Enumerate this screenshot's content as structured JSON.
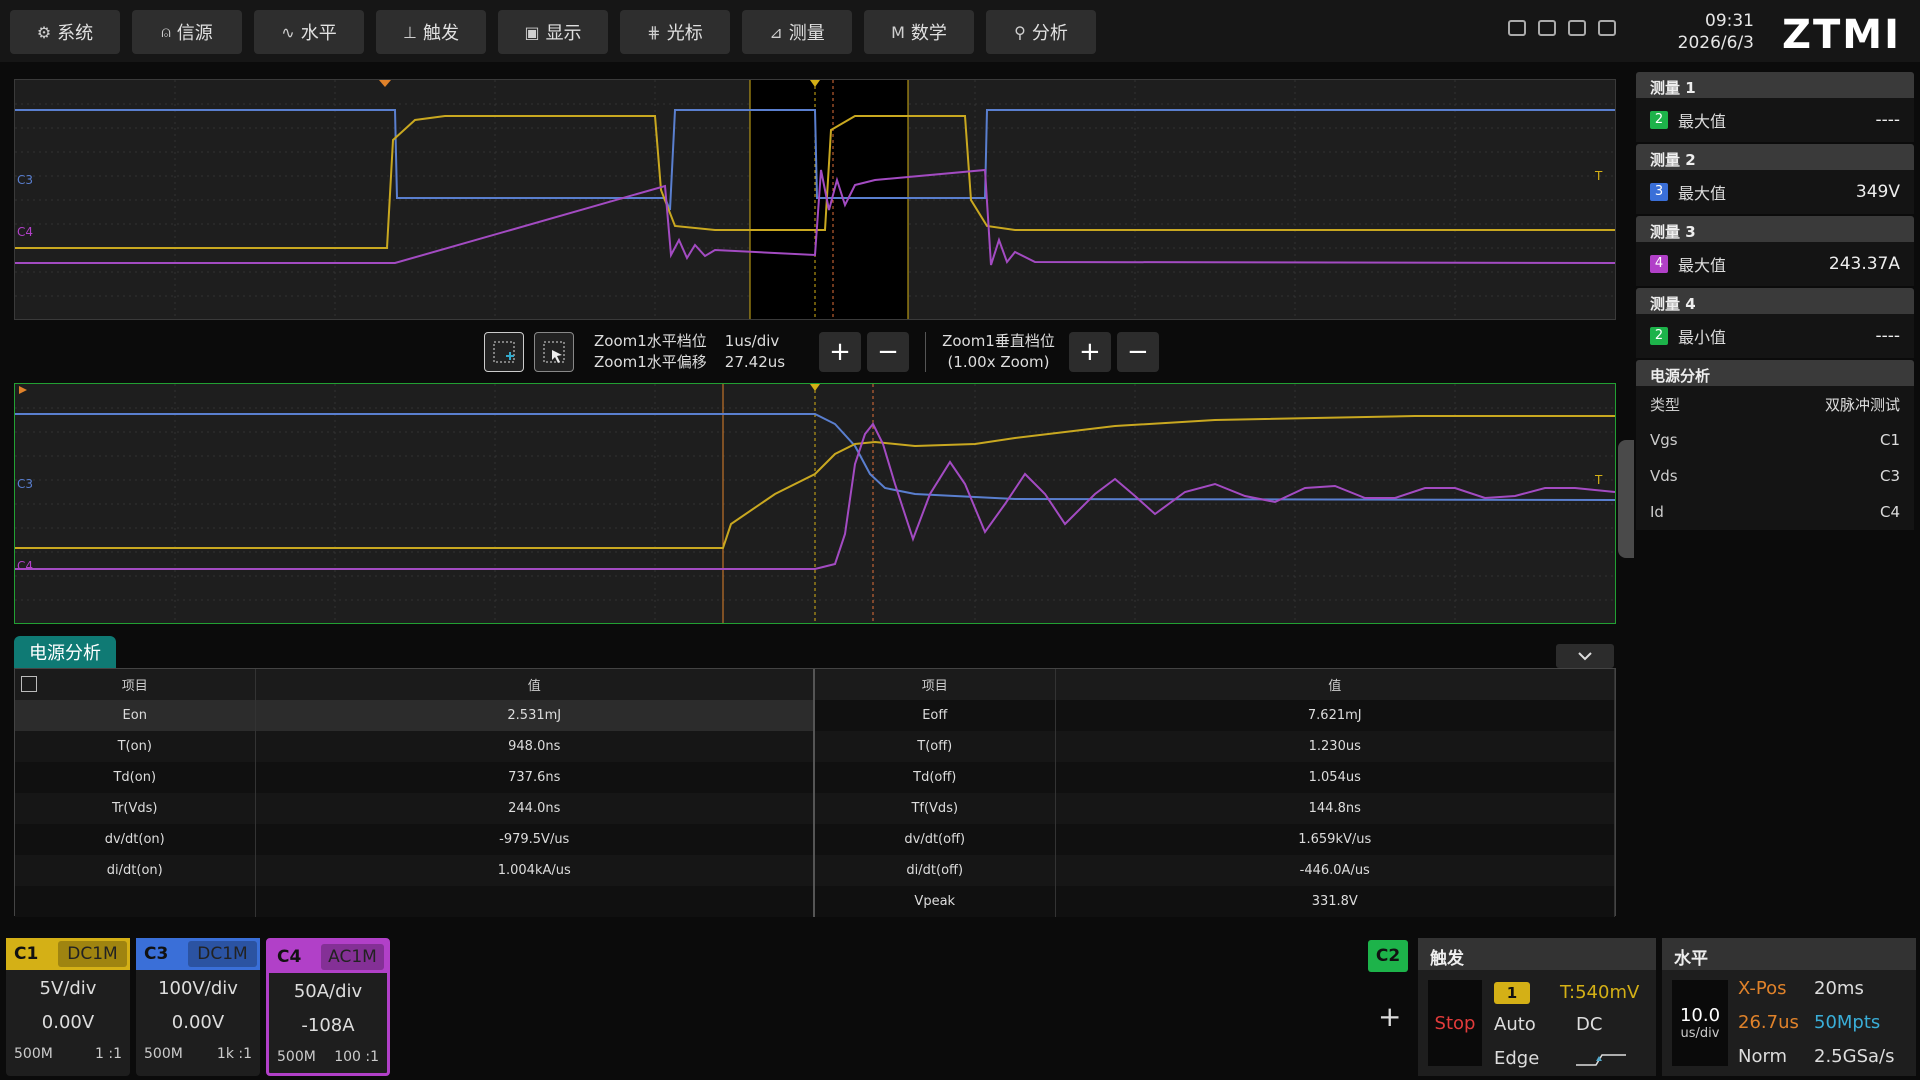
{
  "menu": [
    {
      "icon": "⚙",
      "label": "系统",
      "name": "menu-system"
    },
    {
      "icon": "⍝",
      "label": "信源",
      "name": "menu-source"
    },
    {
      "icon": "∿",
      "label": "水平",
      "name": "menu-horizontal"
    },
    {
      "icon": "⊥",
      "label": "触发",
      "name": "menu-trigger"
    },
    {
      "icon": "▣",
      "label": "显示",
      "name": "menu-display"
    },
    {
      "icon": "⋕",
      "label": "光标",
      "name": "menu-cursor"
    },
    {
      "icon": "⊿",
      "label": "测量",
      "name": "menu-measure"
    },
    {
      "icon": "M",
      "label": "数学",
      "name": "menu-math"
    },
    {
      "icon": "⚲",
      "label": "分析",
      "name": "menu-analysis"
    }
  ],
  "clock": {
    "time": "09:31",
    "date": "2026/6/3"
  },
  "logo": "ZTMI",
  "zoom": {
    "h_scale_label": "Zoom1水平档位",
    "h_scale_value": "1us/div",
    "h_offset_label": "Zoom1水平偏移",
    "h_offset_value": "27.42us",
    "v_scale_label": "Zoom1垂直档位",
    "v_scale_value": "(1.00x Zoom)"
  },
  "channel_markers": {
    "c3": "C3",
    "c4": "C4",
    "trig": "T"
  },
  "measurements": [
    {
      "title": "测量 1",
      "channel": "2",
      "chip_color": "#1db34a",
      "type": "最大值",
      "value": "----"
    },
    {
      "title": "测量 2",
      "channel": "3",
      "chip_color": "#3a6fd8",
      "type": "最大值",
      "value": "349V"
    },
    {
      "title": "测量 3",
      "channel": "4",
      "chip_color": "#b140c8",
      "type": "最大值",
      "value": "243.37A"
    },
    {
      "title": "测量 4",
      "channel": "2",
      "chip_color": "#1db34a",
      "type": "最小值",
      "value": "----"
    }
  ],
  "power_analysis": {
    "title": "电源分析",
    "rows": [
      {
        "label": "类型",
        "value": "双脉冲测试"
      },
      {
        "label": "Vgs",
        "value": "C1"
      },
      {
        "label": "Vds",
        "value": "C3"
      },
      {
        "label": "Id",
        "value": "C4"
      }
    ]
  },
  "analysis_tab": "电源分析",
  "table": {
    "col_item": "项目",
    "col_value": "值",
    "left": [
      [
        "Eon",
        "2.531mJ"
      ],
      [
        "T(on)",
        "948.0ns"
      ],
      [
        "Td(on)",
        "737.6ns"
      ],
      [
        "Tr(Vds)",
        "244.0ns"
      ],
      [
        "dv/dt(on)",
        "-979.5V/us"
      ],
      [
        "di/dt(on)",
        "1.004kA/us"
      ],
      [
        "",
        ""
      ]
    ],
    "right": [
      [
        "Eoff",
        "7.621mJ"
      ],
      [
        "T(off)",
        "1.230us"
      ],
      [
        "Td(off)",
        "1.054us"
      ],
      [
        "Tf(Vds)",
        "144.8ns"
      ],
      [
        "dv/dt(off)",
        "1.659kV/us"
      ],
      [
        "di/dt(off)",
        "-446.0A/us"
      ],
      [
        "Vpeak",
        "331.8V"
      ]
    ]
  },
  "channels": [
    {
      "name": "C1",
      "coupling": "DC1M",
      "color": "#d4b016",
      "div": "5V/div",
      "offset": "0.00V",
      "bw": "500M",
      "probe": "1 :1"
    },
    {
      "name": "C3",
      "coupling": "DC1M",
      "color": "#3a6fd8",
      "div": "100V/div",
      "offset": "0.00V",
      "bw": "500M",
      "probe": "1k :1"
    },
    {
      "name": "C4",
      "coupling": "AC1M",
      "color": "#b140c8",
      "div": "50A/div",
      "offset": "-108A",
      "bw": "500M",
      "probe": "100 :1"
    }
  ],
  "c2_button": "C2",
  "add_button": "+",
  "trigger": {
    "title": "触发",
    "state": "Stop",
    "source": "1",
    "level": "T:540mV",
    "mode": "Auto",
    "coupling": "DC",
    "type": "Edge"
  },
  "horizontal": {
    "title": "水平",
    "time_div": "10.0",
    "time_unit": "us/div",
    "xpos_label": "X-Pos",
    "xpos_value": "20ms",
    "offset": "26.7us",
    "mem": "50Mpts",
    "acq": "Norm",
    "rate": "2.5GSa/s"
  }
}
